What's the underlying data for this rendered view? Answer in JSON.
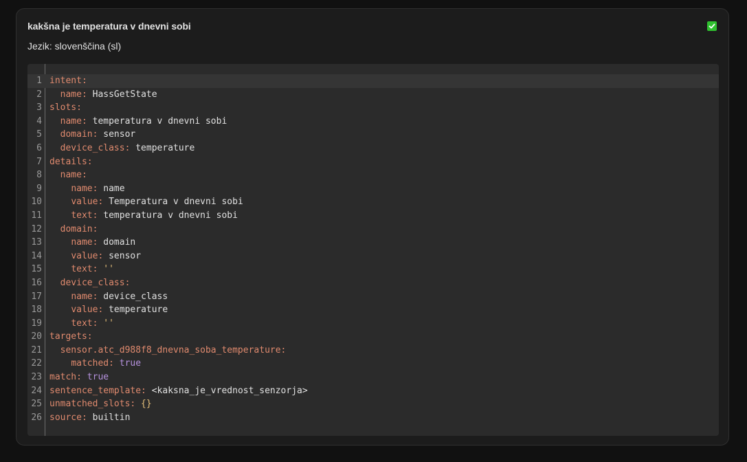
{
  "card": {
    "title": "kakšna je temperatura v dnevni sobi",
    "language": "Jezik: slovenščina (sl)",
    "status_color": "#2fbf2f"
  },
  "editor": {
    "lines": [
      {
        "n": "1",
        "indent": "",
        "key": "intent:",
        "value": "",
        "vtype": "plain"
      },
      {
        "n": "2",
        "indent": "  ",
        "key": "name:",
        "value": " HassGetState",
        "vtype": "plain"
      },
      {
        "n": "3",
        "indent": "",
        "key": "slots:",
        "value": "",
        "vtype": "plain"
      },
      {
        "n": "4",
        "indent": "  ",
        "key": "name:",
        "value": " temperatura v dnevni sobi",
        "vtype": "plain"
      },
      {
        "n": "5",
        "indent": "  ",
        "key": "domain:",
        "value": " sensor",
        "vtype": "plain"
      },
      {
        "n": "6",
        "indent": "  ",
        "key": "device_class:",
        "value": " temperature",
        "vtype": "plain"
      },
      {
        "n": "7",
        "indent": "",
        "key": "details:",
        "value": "",
        "vtype": "plain"
      },
      {
        "n": "8",
        "indent": "  ",
        "key": "name:",
        "value": "",
        "vtype": "plain"
      },
      {
        "n": "9",
        "indent": "    ",
        "key": "name:",
        "value": " name",
        "vtype": "plain"
      },
      {
        "n": "10",
        "indent": "    ",
        "key": "value:",
        "value": " Temperatura v dnevni sobi",
        "vtype": "plain"
      },
      {
        "n": "11",
        "indent": "    ",
        "key": "text:",
        "value": " temperatura v dnevni sobi",
        "vtype": "plain"
      },
      {
        "n": "12",
        "indent": "  ",
        "key": "domain:",
        "value": "",
        "vtype": "plain"
      },
      {
        "n": "13",
        "indent": "    ",
        "key": "name:",
        "value": " domain",
        "vtype": "plain"
      },
      {
        "n": "14",
        "indent": "    ",
        "key": "value:",
        "value": " sensor",
        "vtype": "plain"
      },
      {
        "n": "15",
        "indent": "    ",
        "key": "text:",
        "value": " ''",
        "vtype": "string"
      },
      {
        "n": "16",
        "indent": "  ",
        "key": "device_class:",
        "value": "",
        "vtype": "plain"
      },
      {
        "n": "17",
        "indent": "    ",
        "key": "name:",
        "value": " device_class",
        "vtype": "plain"
      },
      {
        "n": "18",
        "indent": "    ",
        "key": "value:",
        "value": " temperature",
        "vtype": "plain"
      },
      {
        "n": "19",
        "indent": "    ",
        "key": "text:",
        "value": " ''",
        "vtype": "string"
      },
      {
        "n": "20",
        "indent": "",
        "key": "targets:",
        "value": "",
        "vtype": "plain"
      },
      {
        "n": "21",
        "indent": "  ",
        "key": "sensor.atc_d988f8_dnevna_soba_temperature:",
        "value": "",
        "vtype": "plain"
      },
      {
        "n": "22",
        "indent": "    ",
        "key": "matched:",
        "value": " true",
        "vtype": "bool"
      },
      {
        "n": "23",
        "indent": "",
        "key": "match:",
        "value": " true",
        "vtype": "bool"
      },
      {
        "n": "24",
        "indent": "",
        "key": "sentence_template:",
        "value": " <kaksna_je_vrednost_senzorja>",
        "vtype": "plain"
      },
      {
        "n": "25",
        "indent": "",
        "key": "unmatched_slots:",
        "value": " {}",
        "vtype": "string"
      },
      {
        "n": "26",
        "indent": "",
        "key": "source:",
        "value": " builtin",
        "vtype": "plain"
      }
    ]
  }
}
